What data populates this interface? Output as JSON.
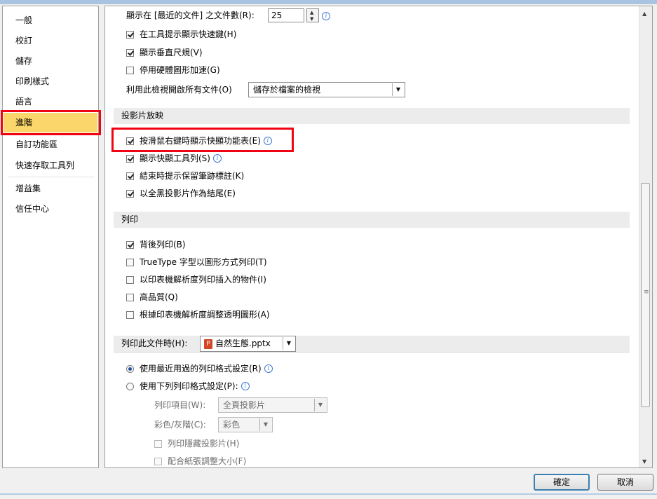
{
  "nav": {
    "items": [
      "一般",
      "校訂",
      "儲存",
      "印刷樣式",
      "語言",
      "進階",
      "自訂功能區",
      "快速存取工具列",
      "增益集",
      "信任中心"
    ],
    "selected": "進階"
  },
  "display": {
    "recent_docs_label": "顯示在 [最近的文件] 之文件數(R):",
    "recent_docs_value": "25",
    "show_tooltip_shortcuts": "在工具提示顯示快速鍵(H)",
    "show_vertical_ruler": "顯示垂直尺規(V)",
    "disable_hw_accel": "停用硬體圖形加速(G)",
    "open_view_label": "利用此檢視開啟所有文件(O)",
    "open_view_value": "儲存於檔案的檢視"
  },
  "slideshow": {
    "header": "投影片放映",
    "right_click_menu": "按滑鼠右鍵時顯示快顯功能表(E)",
    "popup_toolbar": "顯示快顯工具列(S)",
    "keep_ink": "結束時提示保留筆跡標註(K)",
    "end_black": "以全黑投影片作為結尾(E)"
  },
  "print": {
    "header": "列印",
    "background": "背後列印(B)",
    "truetype": "TrueType 字型以圖形方式列印(T)",
    "printer_resolution": "以印表機解析度列印插入的物件(I)",
    "high_quality": "高品質(Q)",
    "align_transparent": "根據印表機解析度調整透明圖形(A)"
  },
  "print_doc": {
    "label": "列印此文件時(H):",
    "file": "自然生態.pptx",
    "recent_settings": "使用最近用過的列印格式設定(R)",
    "following_settings": "使用下列列印格式設定(P):",
    "print_what_label": "列印項目(W):",
    "print_what_value": "全頁投影片",
    "color_label": "彩色/灰階(C):",
    "color_value": "彩色",
    "print_hidden": "列印隱藏投影片(H)",
    "scale_to_fit": "配合紙張調整大小(F)"
  },
  "buttons": {
    "ok": "確定",
    "cancel": "取消"
  },
  "colors": {
    "selected_nav": "#fbd66a",
    "highlight_box": "#f00312",
    "accent": "#3c7fb1"
  },
  "icons": [
    "info-icon",
    "checkbox-checked",
    "checkbox-unchecked",
    "radio-selected",
    "radio-unselected",
    "dropdown-arrow-icon",
    "powerpoint-file-icon"
  ]
}
